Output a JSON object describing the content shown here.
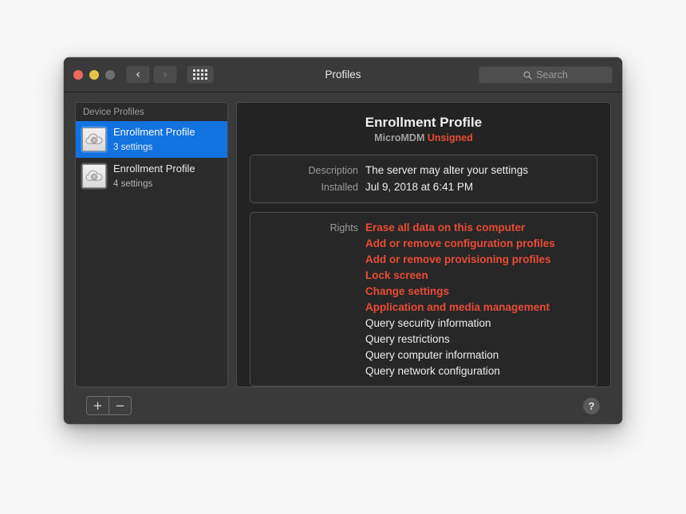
{
  "window": {
    "title": "Profiles",
    "traffic_lights": [
      "close-button",
      "minimize-button",
      "zoom-button"
    ],
    "back_glyph": "‹",
    "forward_glyph": "›",
    "grid_button": "all-preferences-grid"
  },
  "search": {
    "placeholder": "Search",
    "value": ""
  },
  "sidebar": {
    "header": "Device Profiles",
    "items": [
      {
        "name": "Enrollment Profile",
        "subtitle": "3 settings",
        "selected": true
      },
      {
        "name": "Enrollment Profile",
        "subtitle": "4 settings",
        "selected": false
      }
    ]
  },
  "detail": {
    "title": "Enrollment Profile",
    "vendor": "MicroMDM",
    "signature_status": "Unsigned",
    "info": [
      {
        "label": "Description",
        "value": "The server may alter your settings"
      },
      {
        "label": "Installed",
        "value": "Jul 9, 2018 at 6:41 PM"
      }
    ],
    "rights_label": "Rights",
    "rights": [
      {
        "text": "Erase all data on this computer",
        "danger": true
      },
      {
        "text": "Add or remove configuration profiles",
        "danger": true
      },
      {
        "text": "Add or remove provisioning profiles",
        "danger": true
      },
      {
        "text": "Lock screen",
        "danger": true
      },
      {
        "text": "Change settings",
        "danger": true
      },
      {
        "text": "Application and media management",
        "danger": true
      },
      {
        "text": "Query security information",
        "danger": false
      },
      {
        "text": "Query restrictions",
        "danger": false
      },
      {
        "text": "Query computer information",
        "danger": false
      },
      {
        "text": "Query network configuration",
        "danger": false
      }
    ]
  },
  "footer": {
    "add_label": "+",
    "remove_label": "−",
    "help_label": "?"
  },
  "colors": {
    "selection_blue": "#1272e0",
    "danger_red": "#ea4b36",
    "window_chrome": "#3a3a3a",
    "pane_background": "#232323",
    "sidebar_background": "#2b2b2b"
  }
}
